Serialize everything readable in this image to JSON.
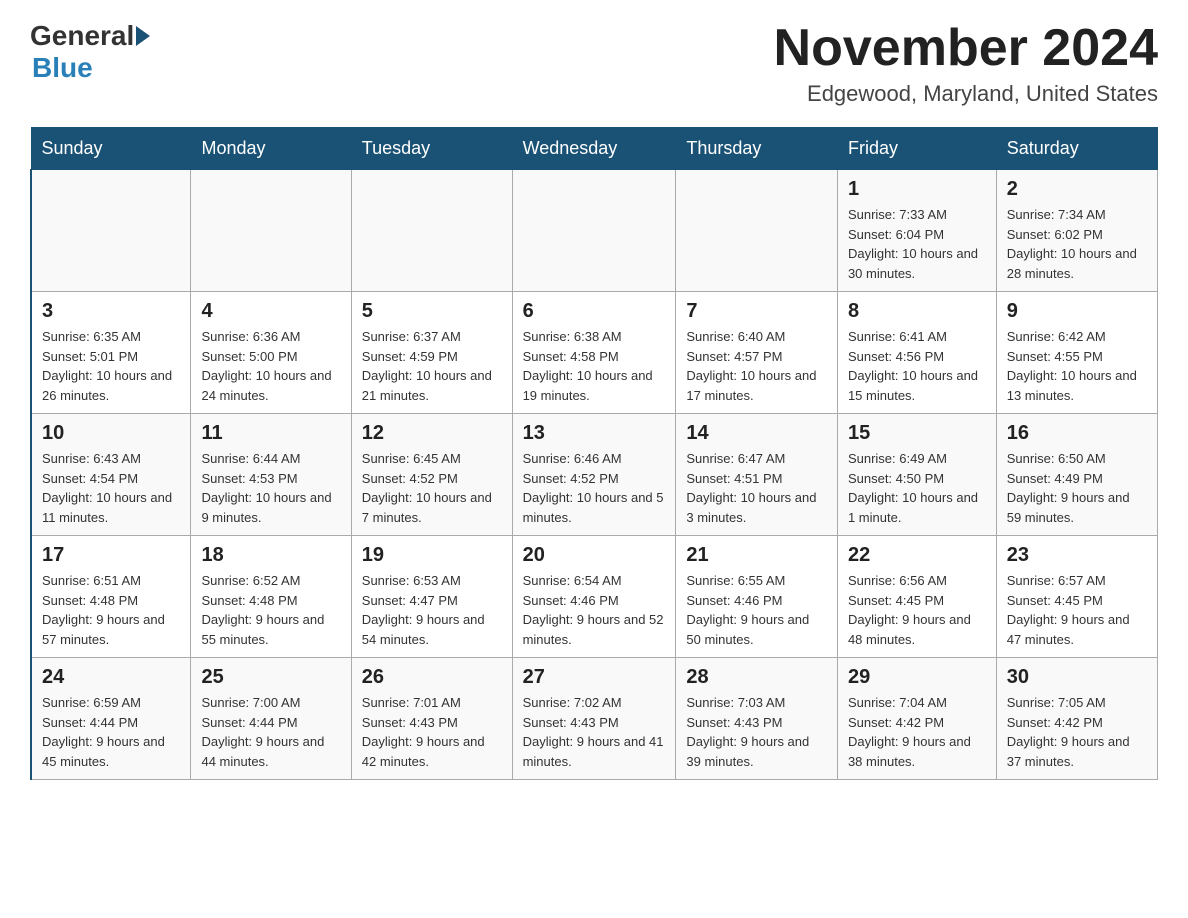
{
  "header": {
    "logo_general": "General",
    "logo_blue": "Blue",
    "month_title": "November 2024",
    "location": "Edgewood, Maryland, United States"
  },
  "days_of_week": [
    "Sunday",
    "Monday",
    "Tuesday",
    "Wednesday",
    "Thursday",
    "Friday",
    "Saturday"
  ],
  "weeks": [
    [
      {
        "day": "",
        "sunrise": "",
        "sunset": "",
        "daylight": ""
      },
      {
        "day": "",
        "sunrise": "",
        "sunset": "",
        "daylight": ""
      },
      {
        "day": "",
        "sunrise": "",
        "sunset": "",
        "daylight": ""
      },
      {
        "day": "",
        "sunrise": "",
        "sunset": "",
        "daylight": ""
      },
      {
        "day": "",
        "sunrise": "",
        "sunset": "",
        "daylight": ""
      },
      {
        "day": "1",
        "sunrise": "Sunrise: 7:33 AM",
        "sunset": "Sunset: 6:04 PM",
        "daylight": "Daylight: 10 hours and 30 minutes."
      },
      {
        "day": "2",
        "sunrise": "Sunrise: 7:34 AM",
        "sunset": "Sunset: 6:02 PM",
        "daylight": "Daylight: 10 hours and 28 minutes."
      }
    ],
    [
      {
        "day": "3",
        "sunrise": "Sunrise: 6:35 AM",
        "sunset": "Sunset: 5:01 PM",
        "daylight": "Daylight: 10 hours and 26 minutes."
      },
      {
        "day": "4",
        "sunrise": "Sunrise: 6:36 AM",
        "sunset": "Sunset: 5:00 PM",
        "daylight": "Daylight: 10 hours and 24 minutes."
      },
      {
        "day": "5",
        "sunrise": "Sunrise: 6:37 AM",
        "sunset": "Sunset: 4:59 PM",
        "daylight": "Daylight: 10 hours and 21 minutes."
      },
      {
        "day": "6",
        "sunrise": "Sunrise: 6:38 AM",
        "sunset": "Sunset: 4:58 PM",
        "daylight": "Daylight: 10 hours and 19 minutes."
      },
      {
        "day": "7",
        "sunrise": "Sunrise: 6:40 AM",
        "sunset": "Sunset: 4:57 PM",
        "daylight": "Daylight: 10 hours and 17 minutes."
      },
      {
        "day": "8",
        "sunrise": "Sunrise: 6:41 AM",
        "sunset": "Sunset: 4:56 PM",
        "daylight": "Daylight: 10 hours and 15 minutes."
      },
      {
        "day": "9",
        "sunrise": "Sunrise: 6:42 AM",
        "sunset": "Sunset: 4:55 PM",
        "daylight": "Daylight: 10 hours and 13 minutes."
      }
    ],
    [
      {
        "day": "10",
        "sunrise": "Sunrise: 6:43 AM",
        "sunset": "Sunset: 4:54 PM",
        "daylight": "Daylight: 10 hours and 11 minutes."
      },
      {
        "day": "11",
        "sunrise": "Sunrise: 6:44 AM",
        "sunset": "Sunset: 4:53 PM",
        "daylight": "Daylight: 10 hours and 9 minutes."
      },
      {
        "day": "12",
        "sunrise": "Sunrise: 6:45 AM",
        "sunset": "Sunset: 4:52 PM",
        "daylight": "Daylight: 10 hours and 7 minutes."
      },
      {
        "day": "13",
        "sunrise": "Sunrise: 6:46 AM",
        "sunset": "Sunset: 4:52 PM",
        "daylight": "Daylight: 10 hours and 5 minutes."
      },
      {
        "day": "14",
        "sunrise": "Sunrise: 6:47 AM",
        "sunset": "Sunset: 4:51 PM",
        "daylight": "Daylight: 10 hours and 3 minutes."
      },
      {
        "day": "15",
        "sunrise": "Sunrise: 6:49 AM",
        "sunset": "Sunset: 4:50 PM",
        "daylight": "Daylight: 10 hours and 1 minute."
      },
      {
        "day": "16",
        "sunrise": "Sunrise: 6:50 AM",
        "sunset": "Sunset: 4:49 PM",
        "daylight": "Daylight: 9 hours and 59 minutes."
      }
    ],
    [
      {
        "day": "17",
        "sunrise": "Sunrise: 6:51 AM",
        "sunset": "Sunset: 4:48 PM",
        "daylight": "Daylight: 9 hours and 57 minutes."
      },
      {
        "day": "18",
        "sunrise": "Sunrise: 6:52 AM",
        "sunset": "Sunset: 4:48 PM",
        "daylight": "Daylight: 9 hours and 55 minutes."
      },
      {
        "day": "19",
        "sunrise": "Sunrise: 6:53 AM",
        "sunset": "Sunset: 4:47 PM",
        "daylight": "Daylight: 9 hours and 54 minutes."
      },
      {
        "day": "20",
        "sunrise": "Sunrise: 6:54 AM",
        "sunset": "Sunset: 4:46 PM",
        "daylight": "Daylight: 9 hours and 52 minutes."
      },
      {
        "day": "21",
        "sunrise": "Sunrise: 6:55 AM",
        "sunset": "Sunset: 4:46 PM",
        "daylight": "Daylight: 9 hours and 50 minutes."
      },
      {
        "day": "22",
        "sunrise": "Sunrise: 6:56 AM",
        "sunset": "Sunset: 4:45 PM",
        "daylight": "Daylight: 9 hours and 48 minutes."
      },
      {
        "day": "23",
        "sunrise": "Sunrise: 6:57 AM",
        "sunset": "Sunset: 4:45 PM",
        "daylight": "Daylight: 9 hours and 47 minutes."
      }
    ],
    [
      {
        "day": "24",
        "sunrise": "Sunrise: 6:59 AM",
        "sunset": "Sunset: 4:44 PM",
        "daylight": "Daylight: 9 hours and 45 minutes."
      },
      {
        "day": "25",
        "sunrise": "Sunrise: 7:00 AM",
        "sunset": "Sunset: 4:44 PM",
        "daylight": "Daylight: 9 hours and 44 minutes."
      },
      {
        "day": "26",
        "sunrise": "Sunrise: 7:01 AM",
        "sunset": "Sunset: 4:43 PM",
        "daylight": "Daylight: 9 hours and 42 minutes."
      },
      {
        "day": "27",
        "sunrise": "Sunrise: 7:02 AM",
        "sunset": "Sunset: 4:43 PM",
        "daylight": "Daylight: 9 hours and 41 minutes."
      },
      {
        "day": "28",
        "sunrise": "Sunrise: 7:03 AM",
        "sunset": "Sunset: 4:43 PM",
        "daylight": "Daylight: 9 hours and 39 minutes."
      },
      {
        "day": "29",
        "sunrise": "Sunrise: 7:04 AM",
        "sunset": "Sunset: 4:42 PM",
        "daylight": "Daylight: 9 hours and 38 minutes."
      },
      {
        "day": "30",
        "sunrise": "Sunrise: 7:05 AM",
        "sunset": "Sunset: 4:42 PM",
        "daylight": "Daylight: 9 hours and 37 minutes."
      }
    ]
  ]
}
